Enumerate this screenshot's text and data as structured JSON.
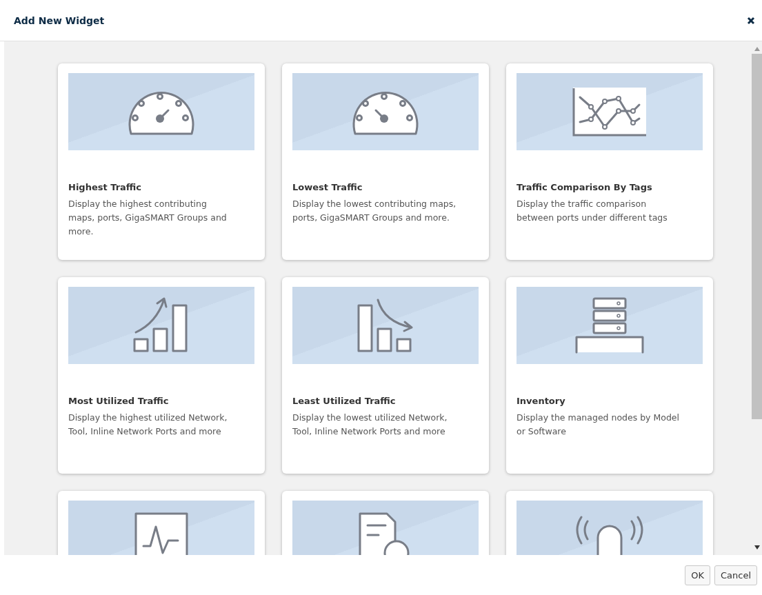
{
  "dialog": {
    "title": "Add New Widget"
  },
  "widgets": [
    {
      "kind": "gauge-high",
      "title": "Highest Traffic",
      "description": "Display the highest contributing maps, ports, GigaSMART Groups and more."
    },
    {
      "kind": "gauge-low",
      "title": "Lowest Traffic",
      "description": "Display the lowest contributing maps, ports, GigaSMART Groups and more."
    },
    {
      "kind": "line-chart",
      "title": "Traffic Comparison By Tags",
      "description": "Display the traffic comparison between ports under different tags"
    },
    {
      "kind": "bars-up",
      "title": "Most Utilized Traffic",
      "description": "Display the highest utilized Network, Tool, Inline Network Ports and more"
    },
    {
      "kind": "bars-down",
      "title": "Least Utilized Traffic",
      "description": "Display the lowest utilized Network, Tool, Inline Network Ports and more"
    },
    {
      "kind": "servers",
      "title": "Inventory",
      "description": "Display the managed nodes by Model or Software"
    },
    {
      "kind": "pulse"
    },
    {
      "kind": "document"
    },
    {
      "kind": "alarm"
    }
  ],
  "buttons": [
    "OK",
    "Cancel"
  ]
}
